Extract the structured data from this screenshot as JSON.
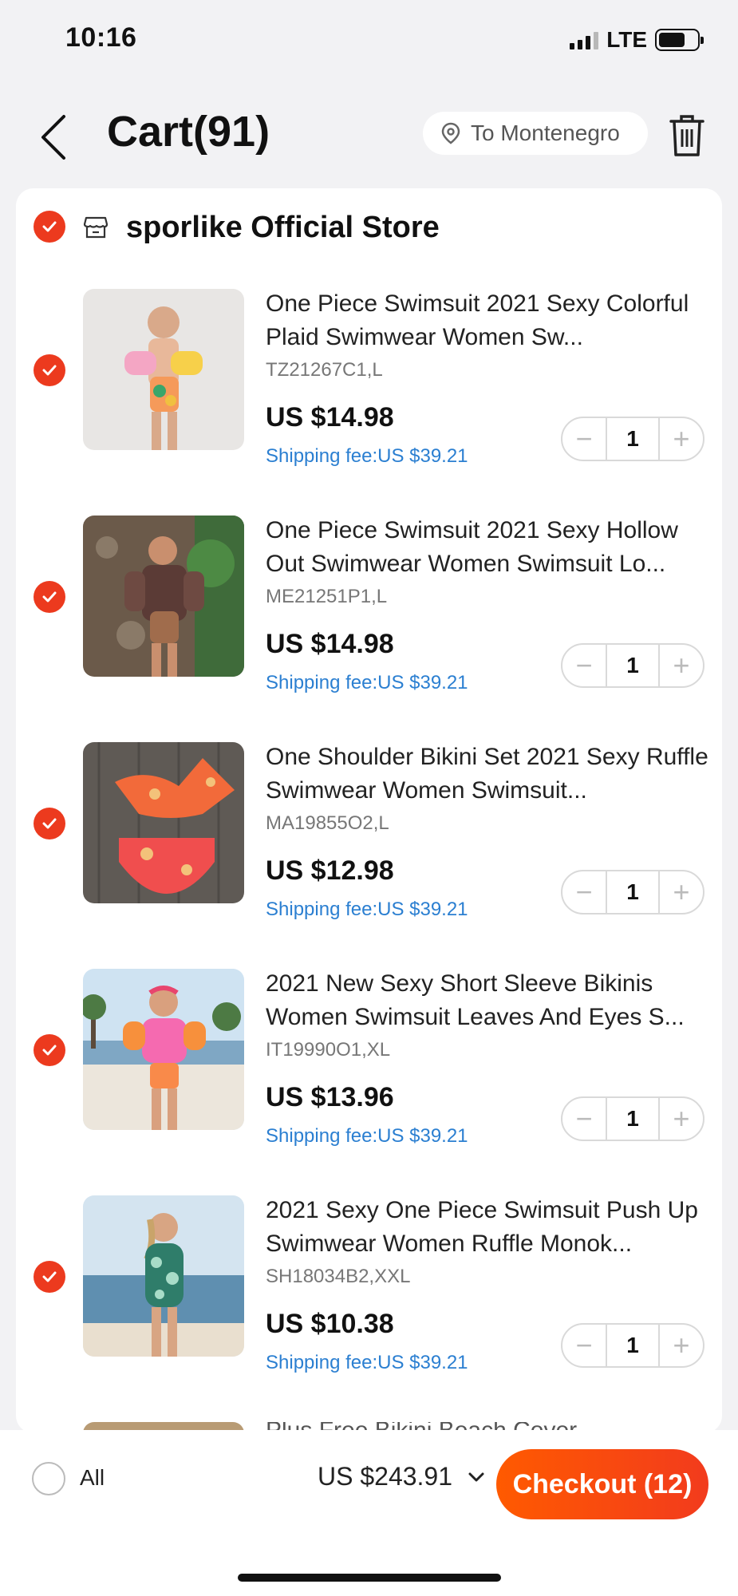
{
  "status_bar": {
    "time": "10:16",
    "network": "LTE"
  },
  "header": {
    "back_icon": "chevron-left-icon",
    "title": "Cart(91)",
    "location": "To Montenegro",
    "location_icon": "location-pin-icon",
    "trash_icon": "trash-icon"
  },
  "store": {
    "name": "sporlike Official Store",
    "checked": true,
    "icon": "store-icon"
  },
  "items": [
    {
      "title": "One Piece Swimsuit 2021 Sexy Colorful Plaid Swimwear Women Sw...",
      "sku": "TZ21267C1,L",
      "price": "US $14.98",
      "shipping": "Shipping fee:US $39.21",
      "quantity": "1",
      "checked": true
    },
    {
      "title": "One Piece Swimsuit 2021 Sexy Hollow Out Swimwear Women Swimsuit Lo...",
      "sku": "ME21251P1,L",
      "price": "US $14.98",
      "shipping": "Shipping fee:US $39.21",
      "quantity": "1",
      "checked": true
    },
    {
      "title": "One Shoulder Bikini Set 2021 Sexy Ruffle Swimwear Women Swimsuit...",
      "sku": "MA19855O2,L",
      "price": "US $12.98",
      "shipping": "Shipping fee:US $39.21",
      "quantity": "1",
      "checked": true
    },
    {
      "title": "2021 New Sexy Short Sleeve Bikinis Women Swimsuit Leaves And Eyes S...",
      "sku": "IT19990O1,XL",
      "price": "US $13.96",
      "shipping": "Shipping fee:US $39.21",
      "quantity": "1",
      "checked": true
    },
    {
      "title": "2021 Sexy One Piece Swimsuit Push Up Swimwear Women Ruffle Monok...",
      "sku": "SH18034B2,XXL",
      "price": "US $10.38",
      "shipping": "Shipping fee:US $39.21",
      "quantity": "1",
      "checked": true
    }
  ],
  "peek_item": {
    "title": "Plus Free Bikini Beach Cover"
  },
  "stepper": {
    "minus": "−",
    "plus": "+"
  },
  "bottom_bar": {
    "all_label": "All",
    "all_checked": false,
    "total": "US $243.91",
    "checkout": "Checkout (12)"
  },
  "colors": {
    "accent": "#ec3a1e",
    "link": "#2b7fd1",
    "checkout_start": "#ff5a00",
    "checkout_end": "#f23b1d"
  }
}
